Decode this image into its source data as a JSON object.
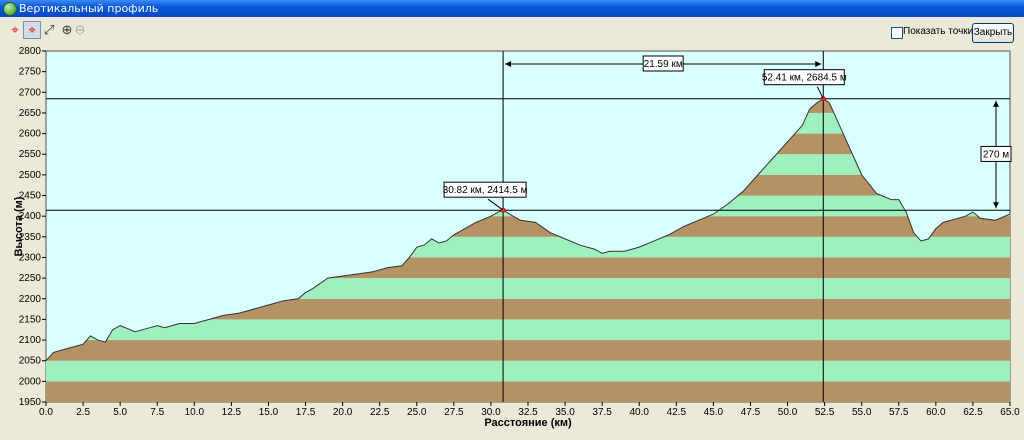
{
  "window": {
    "title": "Вертикальный профиль"
  },
  "toolbar": {
    "tools": [
      "crosshair-icon",
      "crosshair-select-icon",
      "zoom-area-icon",
      "zoom-in-icon",
      "zoom-out-icon"
    ],
    "show_points_label": "Показать точки пути",
    "show_points_checked": false,
    "close_label": "Закрыть"
  },
  "chart_data": {
    "type": "area",
    "xlabel": "Расстояние   (км)",
    "ylabel": "Высота (м)",
    "xlim": [
      0,
      65
    ],
    "ylim": [
      1950,
      2800
    ],
    "x_ticks": [
      "0.0",
      "2.5",
      "5.0",
      "7.5",
      "10.0",
      "12.5",
      "15.0",
      "17.5",
      "20.0",
      "22.5",
      "25.0",
      "27.5",
      "30.0",
      "32.5",
      "35.0",
      "37.5",
      "40.0",
      "42.5",
      "45.0",
      "47.5",
      "50.0",
      "52.5",
      "55.0",
      "57.5",
      "60.0",
      "62.5",
      "65.0"
    ],
    "y_ticks": [
      "1950",
      "2000",
      "2050",
      "2100",
      "2150",
      "2200",
      "2250",
      "2300",
      "2350",
      "2400",
      "2450",
      "2500",
      "2550",
      "2600",
      "2650",
      "2700",
      "2750",
      "2800"
    ],
    "x": [
      0,
      0.5,
      1,
      2,
      2.5,
      3,
      3.5,
      4,
      4.5,
      5,
      6,
      7,
      7.5,
      8,
      9,
      10,
      11,
      12,
      13,
      14,
      15,
      16,
      17,
      17.5,
      18,
      19,
      20,
      21,
      22,
      23,
      24,
      24.5,
      25,
      25.5,
      26,
      26.5,
      27,
      27.5,
      28,
      29,
      30,
      30.5,
      30.82,
      31.5,
      32,
      33,
      34,
      35,
      36,
      37,
      37.5,
      38,
      39,
      40,
      41,
      42,
      43,
      44,
      45,
      46,
      47,
      48,
      49,
      50,
      51,
      51.5,
      52,
      52.41,
      52.8,
      53,
      53.5,
      54,
      54.5,
      55,
      56,
      57,
      57.5,
      58,
      58.5,
      59,
      59.5,
      60,
      60.5,
      61,
      62,
      62.5,
      63,
      64,
      65
    ],
    "y": [
      2050,
      2070,
      2075,
      2085,
      2090,
      2110,
      2100,
      2095,
      2125,
      2135,
      2120,
      2130,
      2135,
      2130,
      2140,
      2140,
      2150,
      2160,
      2165,
      2175,
      2185,
      2195,
      2200,
      2215,
      2225,
      2250,
      2255,
      2260,
      2265,
      2275,
      2280,
      2300,
      2325,
      2330,
      2345,
      2335,
      2340,
      2355,
      2365,
      2385,
      2400,
      2410,
      2414.5,
      2400,
      2390,
      2385,
      2360,
      2345,
      2330,
      2320,
      2310,
      2315,
      2315,
      2325,
      2340,
      2355,
      2375,
      2390,
      2405,
      2430,
      2460,
      2500,
      2540,
      2580,
      2620,
      2660,
      2675,
      2684.5,
      2675,
      2660,
      2620,
      2580,
      2540,
      2500,
      2455,
      2440,
      2440,
      2410,
      2360,
      2340,
      2345,
      2370,
      2385,
      2390,
      2400,
      2410,
      2395,
      2390,
      2405
    ],
    "markers": [
      {
        "label": "30.82 км, 2414.5 м",
        "x": 30.82,
        "y": 2414.5
      },
      {
        "label": "52.41 км, 2684.5 м",
        "x": 52.41,
        "y": 2684.5
      }
    ],
    "distance_label": "21.59 км",
    "height_diff_label": "270 м",
    "colors": {
      "background": "#d9ffff",
      "band_green": "#9ff0bf",
      "band_brown": "#b49264",
      "line": "#333333"
    }
  }
}
